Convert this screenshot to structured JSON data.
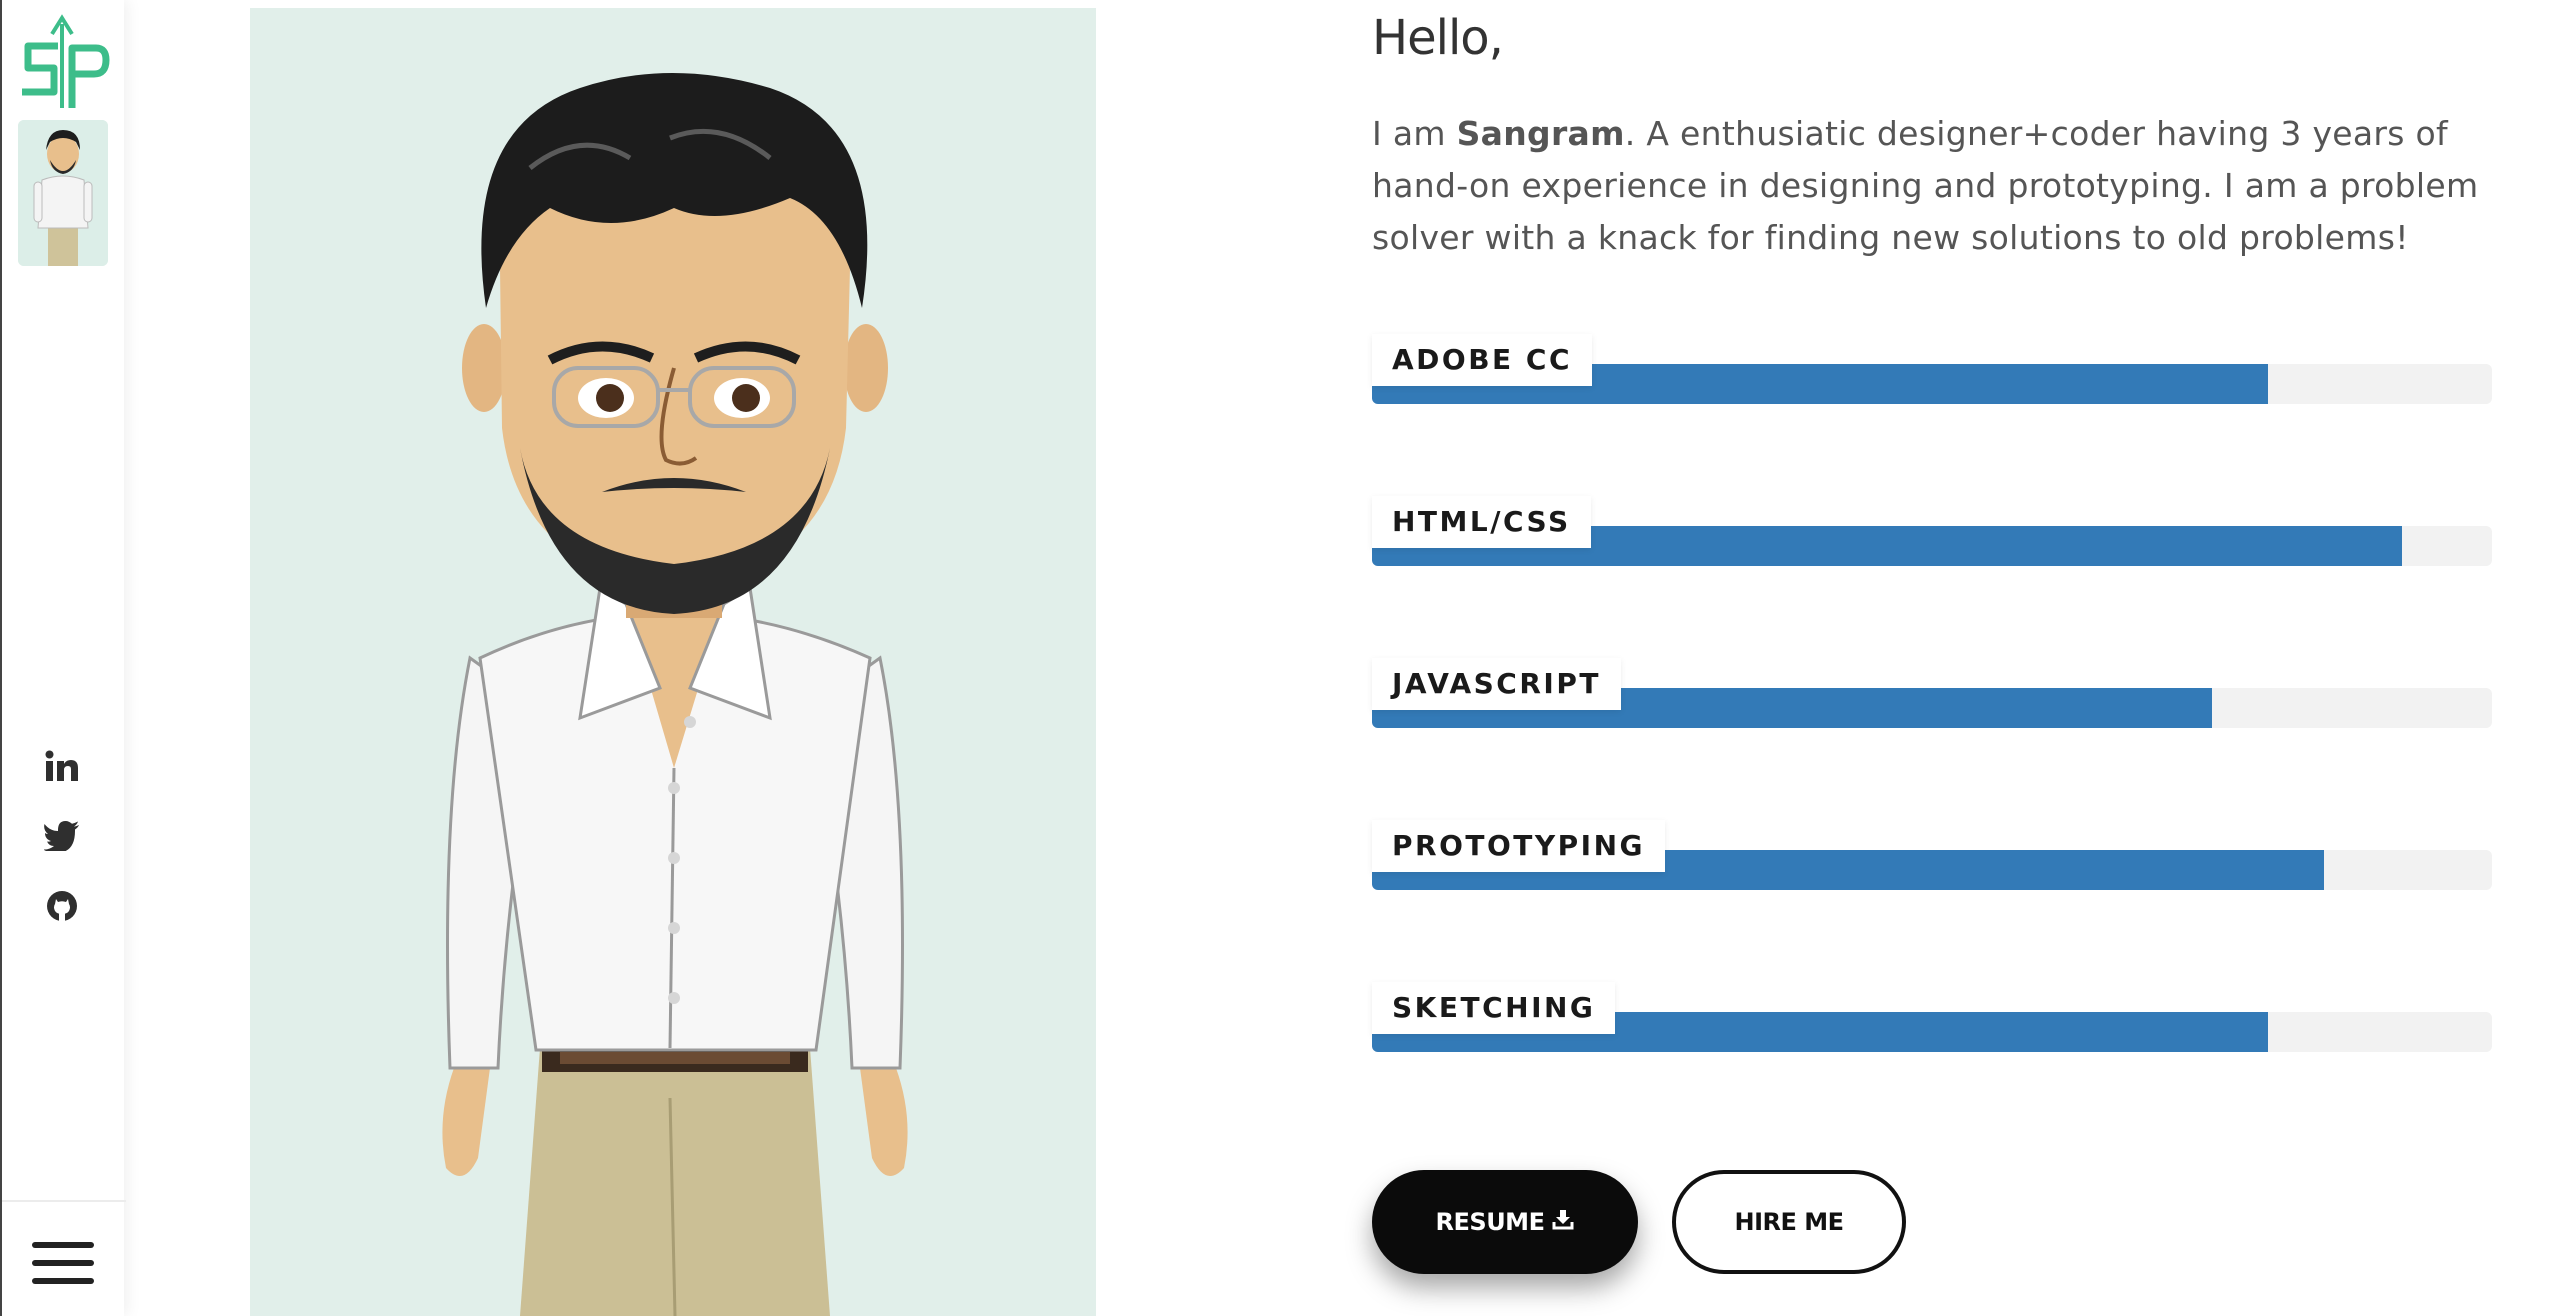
{
  "sidebar": {
    "logo_text": "SP",
    "social": [
      {
        "icon": "linkedin-icon",
        "label": "in"
      },
      {
        "icon": "twitter-icon"
      },
      {
        "icon": "github-icon"
      }
    ]
  },
  "content": {
    "greeting": "Hello,",
    "intro_prefix": "I am ",
    "intro_name": "Sangram",
    "intro_suffix": ". A enthusiatic designer+coder having 3 years of hand-on experience in designing and prototyping. I am a problem solver with a knack for finding new solutions to old problems!"
  },
  "skills": [
    {
      "label": "ADOBE CC",
      "percent": 80
    },
    {
      "label": "HTML/CSS",
      "percent": 92
    },
    {
      "label": "JAVASCRIPT",
      "percent": 75
    },
    {
      "label": "PROTOTYPING",
      "percent": 85
    },
    {
      "label": "SKETCHING",
      "percent": 80
    }
  ],
  "buttons": {
    "resume": "RESUME",
    "hire": "HIRE ME"
  },
  "colors": {
    "accent": "#337ab7",
    "logo": "#3dbd8a",
    "track": "#f2f2f2",
    "portrait_bg": "#e1efea"
  }
}
